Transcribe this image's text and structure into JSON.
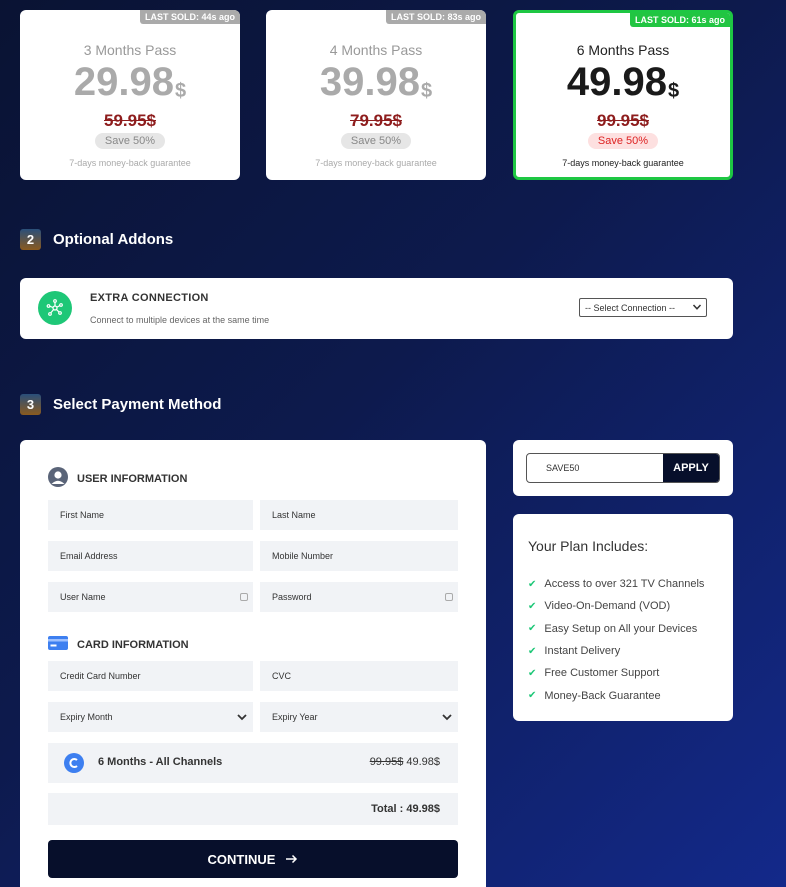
{
  "plans": [
    {
      "badge": "LAST SOLD: 44s ago",
      "name": "3 Months Pass",
      "price": "29.98",
      "currency": "$",
      "old_price": "59.95$",
      "save": "Save 50%",
      "guarantee": "7-days money-back guarantee"
    },
    {
      "badge": "LAST SOLD: 83s ago",
      "name": "4 Months Pass",
      "price": "39.98",
      "currency": "$",
      "old_price": "79.95$",
      "save": "Save 50%",
      "guarantee": "7-days money-back guarantee"
    },
    {
      "badge": "LAST SOLD: 61s ago",
      "name": "6 Months Pass",
      "price": "49.98",
      "currency": "$",
      "old_price": "99.95$",
      "save": "Save 50%",
      "guarantee": "7-days money-back guarantee"
    }
  ],
  "sections": {
    "addons": {
      "number": "2",
      "title": "Optional Addons"
    },
    "payment": {
      "number": "3",
      "title": "Select Payment Method"
    }
  },
  "addon": {
    "title": "EXTRA CONNECTION",
    "subtitle": "Connect to multiple devices at the same time",
    "select_value": "-- Select Connection --"
  },
  "user_info": {
    "heading": "USER INFORMATION",
    "first_name": "First Name",
    "last_name": "Last Name",
    "email": "Email Address",
    "mobile": "Mobile Number",
    "username": "User Name",
    "password": "Password"
  },
  "card_info": {
    "heading": "CARD INFORMATION",
    "card_number": "Credit Card Number",
    "cvc": "CVC",
    "expiry_month": "Expiry Month",
    "expiry_year": "Expiry Year"
  },
  "summary": {
    "plan": "6 Months - All Channels",
    "old_price": "99.95$",
    "price": "49.98$",
    "total": "Total : 49.98$"
  },
  "continue_label": "CONTINUE",
  "coupon": {
    "code": "SAVE50",
    "apply_label": "APPLY"
  },
  "includes": {
    "title": "Your Plan Includes:",
    "items": [
      "Access to over 321 TV Channels",
      "Video-On-Demand (VOD)",
      "Easy Setup on All your Devices",
      "Instant Delivery",
      "Free Customer Support",
      "Money-Back Guarantee"
    ]
  },
  "colors": {
    "accent_green": "#1ec743",
    "dark_button": "#070f2b",
    "strike_red": "#8e1d1d"
  }
}
